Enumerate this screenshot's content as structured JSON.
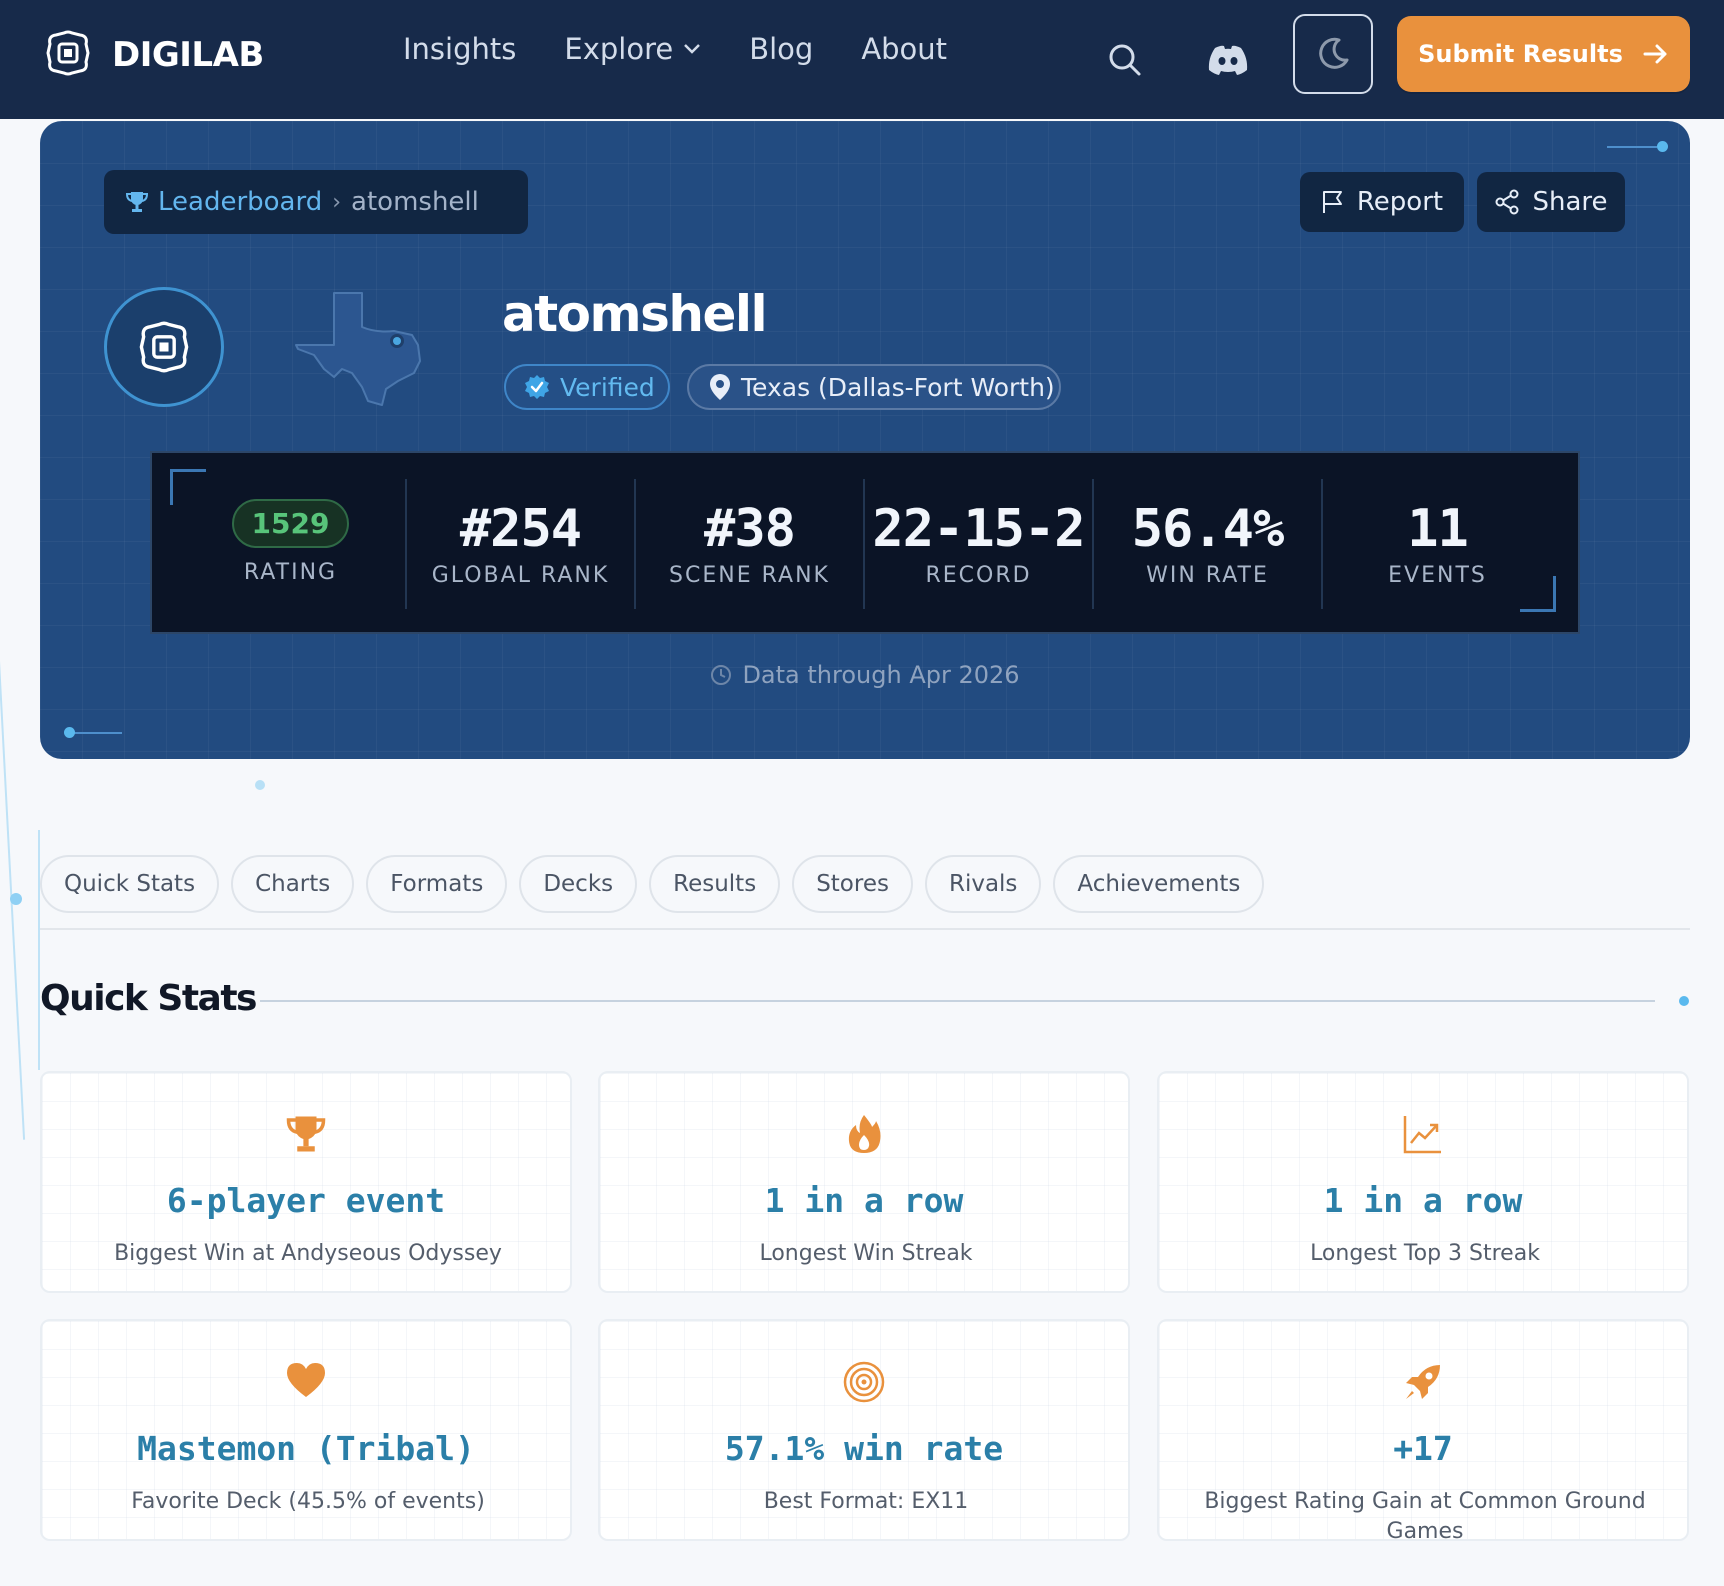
{
  "nav": {
    "brand": "DIGILAB",
    "links": [
      "Insights",
      "Explore",
      "Blog",
      "About"
    ],
    "submit_label": "Submit Results"
  },
  "hero": {
    "breadcrumb": {
      "root": "Leaderboard",
      "current": "atomshell"
    },
    "report_label": "Report",
    "share_label": "Share",
    "player_name": "atomshell",
    "verified_label": "Verified",
    "location": "Texas (Dallas-Fort Worth)",
    "stats": [
      {
        "value": "1529",
        "label": "RATING"
      },
      {
        "value": "#254",
        "label": "GLOBAL RANK"
      },
      {
        "value": "#38",
        "label": "SCENE RANK"
      },
      {
        "value": "22-15-2",
        "label": "RECORD"
      },
      {
        "value": "56.4%",
        "label": "WIN RATE"
      },
      {
        "value": "11",
        "label": "EVENTS"
      }
    ],
    "data_through": "Data through Apr 2026"
  },
  "tabs": [
    "Quick Stats",
    "Charts",
    "Formats",
    "Decks",
    "Results",
    "Stores",
    "Rivals",
    "Achievements"
  ],
  "quick_stats": {
    "title": "Quick Stats",
    "cards": [
      {
        "icon": "trophy-icon",
        "value": "6-player event",
        "label": "Biggest Win at Andyseous Odyssey"
      },
      {
        "icon": "flame-icon",
        "value": "1 in a row",
        "label": "Longest Win Streak"
      },
      {
        "icon": "trend-chart-icon",
        "value": "1 in a row",
        "label": "Longest Top 3 Streak"
      },
      {
        "icon": "heart-icon",
        "value": "Mastemon (Tribal)",
        "label": "Favorite Deck (45.5% of events)"
      },
      {
        "icon": "target-icon",
        "value": "57.1% win rate",
        "label": "Best Format: EX11"
      },
      {
        "icon": "rocket-icon",
        "value": "+17",
        "label": "Biggest Rating Gain at Common Ground Games"
      }
    ]
  },
  "colors": {
    "nav_bg": "#172a4a",
    "hero_bg": "#224b80",
    "accent_orange": "#e9913d",
    "accent_blue": "#63b6ee",
    "rating_green": "#58c47a"
  }
}
